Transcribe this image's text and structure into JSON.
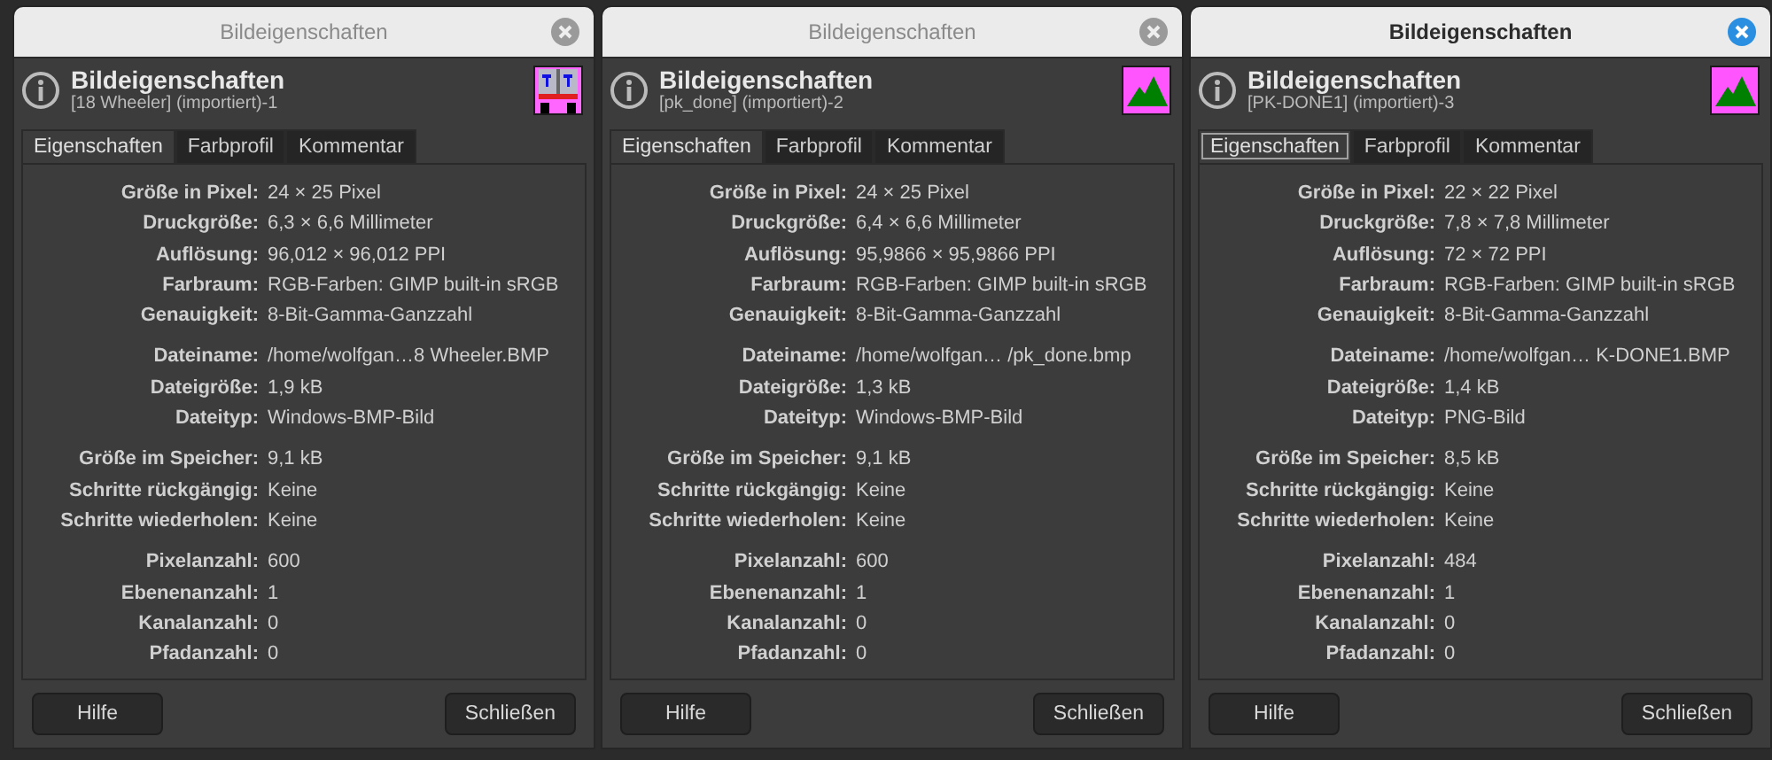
{
  "windows": [
    {
      "title": "Bildeigenschaften",
      "active": false,
      "heading": "Bildeigenschaften",
      "subtitle": "[18 Wheeler] (importiert)-1",
      "thumbnail": {
        "kind": "truck"
      },
      "tabs": [
        {
          "label": "Eigenschaften",
          "selected": true,
          "focused": false
        },
        {
          "label": "Farbprofil",
          "selected": false,
          "focused": false
        },
        {
          "label": "Kommentar",
          "selected": false,
          "focused": false
        }
      ],
      "groups": [
        [
          {
            "label": "Größe in Pixel:",
            "value": "24 × 25 Pixel"
          },
          {
            "label": "Druckgröße:",
            "value": "6,3 × 6,6 Millimeter"
          },
          {
            "label": "Auflösung:",
            "value": "96,012 × 96,012 PPI"
          },
          {
            "label": "Farbraum:",
            "value": "RGB-Farben: GIMP built-in sRGB"
          },
          {
            "label": "Genauigkeit:",
            "value": "8-Bit-Gamma-Ganzzahl"
          }
        ],
        [
          {
            "label": "Dateiname:",
            "value": "/home/wolfgan…8 Wheeler.BMP"
          },
          {
            "label": "Dateigröße:",
            "value": "1,9 kB"
          },
          {
            "label": "Dateityp:",
            "value": "Windows-BMP-Bild"
          }
        ],
        [
          {
            "label": "Größe im Speicher:",
            "value": "9,1 kB"
          },
          {
            "label": "Schritte rückgängig:",
            "value": "Keine"
          },
          {
            "label": "Schritte wiederholen:",
            "value": "Keine"
          }
        ],
        [
          {
            "label": "Pixelanzahl:",
            "value": "600"
          },
          {
            "label": "Ebenenanzahl:",
            "value": "1"
          },
          {
            "label": "Kanalanzahl:",
            "value": "0"
          },
          {
            "label": "Pfadanzahl:",
            "value": "0"
          }
        ]
      ],
      "buttons": [
        "Hilfe",
        "Schließen"
      ]
    },
    {
      "title": "Bildeigenschaften",
      "active": false,
      "heading": "Bildeigenschaften",
      "subtitle": "[pk_done] (importiert)-2",
      "thumbnail": {
        "kind": "mountain"
      },
      "tabs": [
        {
          "label": "Eigenschaften",
          "selected": true,
          "focused": false
        },
        {
          "label": "Farbprofil",
          "selected": false,
          "focused": false
        },
        {
          "label": "Kommentar",
          "selected": false,
          "focused": false
        }
      ],
      "groups": [
        [
          {
            "label": "Größe in Pixel:",
            "value": "24 × 25 Pixel"
          },
          {
            "label": "Druckgröße:",
            "value": "6,4 × 6,6 Millimeter"
          },
          {
            "label": "Auflösung:",
            "value": "95,9866 × 95,9866 PPI"
          },
          {
            "label": "Farbraum:",
            "value": "RGB-Farben: GIMP built-in sRGB"
          },
          {
            "label": "Genauigkeit:",
            "value": "8-Bit-Gamma-Ganzzahl"
          }
        ],
        [
          {
            "label": "Dateiname:",
            "value": "/home/wolfgan… /pk_done.bmp"
          },
          {
            "label": "Dateigröße:",
            "value": "1,3 kB"
          },
          {
            "label": "Dateityp:",
            "value": "Windows-BMP-Bild"
          }
        ],
        [
          {
            "label": "Größe im Speicher:",
            "value": "9,1 kB"
          },
          {
            "label": "Schritte rückgängig:",
            "value": "Keine"
          },
          {
            "label": "Schritte wiederholen:",
            "value": "Keine"
          }
        ],
        [
          {
            "label": "Pixelanzahl:",
            "value": "600"
          },
          {
            "label": "Ebenenanzahl:",
            "value": "1"
          },
          {
            "label": "Kanalanzahl:",
            "value": "0"
          },
          {
            "label": "Pfadanzahl:",
            "value": "0"
          }
        ]
      ],
      "buttons": [
        "Hilfe",
        "Schließen"
      ]
    },
    {
      "title": "Bildeigenschaften",
      "active": true,
      "heading": "Bildeigenschaften",
      "subtitle": "[PK-DONE1] (importiert)-3",
      "thumbnail": {
        "kind": "mountain"
      },
      "tabs": [
        {
          "label": "Eigenschaften",
          "selected": true,
          "focused": true
        },
        {
          "label": "Farbprofil",
          "selected": false,
          "focused": false
        },
        {
          "label": "Kommentar",
          "selected": false,
          "focused": false
        }
      ],
      "groups": [
        [
          {
            "label": "Größe in Pixel:",
            "value": "22 × 22 Pixel"
          },
          {
            "label": "Druckgröße:",
            "value": "7,8 × 7,8 Millimeter"
          },
          {
            "label": "Auflösung:",
            "value": "72 × 72 PPI"
          },
          {
            "label": "Farbraum:",
            "value": "RGB-Farben: GIMP built-in sRGB"
          },
          {
            "label": "Genauigkeit:",
            "value": "8-Bit-Gamma-Ganzzahl"
          }
        ],
        [
          {
            "label": "Dateiname:",
            "value": "/home/wolfgan… K-DONE1.BMP"
          },
          {
            "label": "Dateigröße:",
            "value": "1,4 kB"
          },
          {
            "label": "Dateityp:",
            "value": "PNG-Bild"
          }
        ],
        [
          {
            "label": "Größe im Speicher:",
            "value": "8,5 kB"
          },
          {
            "label": "Schritte rückgängig:",
            "value": "Keine"
          },
          {
            "label": "Schritte wiederholen:",
            "value": "Keine"
          }
        ],
        [
          {
            "label": "Pixelanzahl:",
            "value": "484"
          },
          {
            "label": "Ebenenanzahl:",
            "value": "1"
          },
          {
            "label": "Kanalanzahl:",
            "value": "0"
          },
          {
            "label": "Pfadanzahl:",
            "value": "0"
          }
        ]
      ],
      "buttons": [
        "Hilfe",
        "Schließen"
      ]
    }
  ]
}
